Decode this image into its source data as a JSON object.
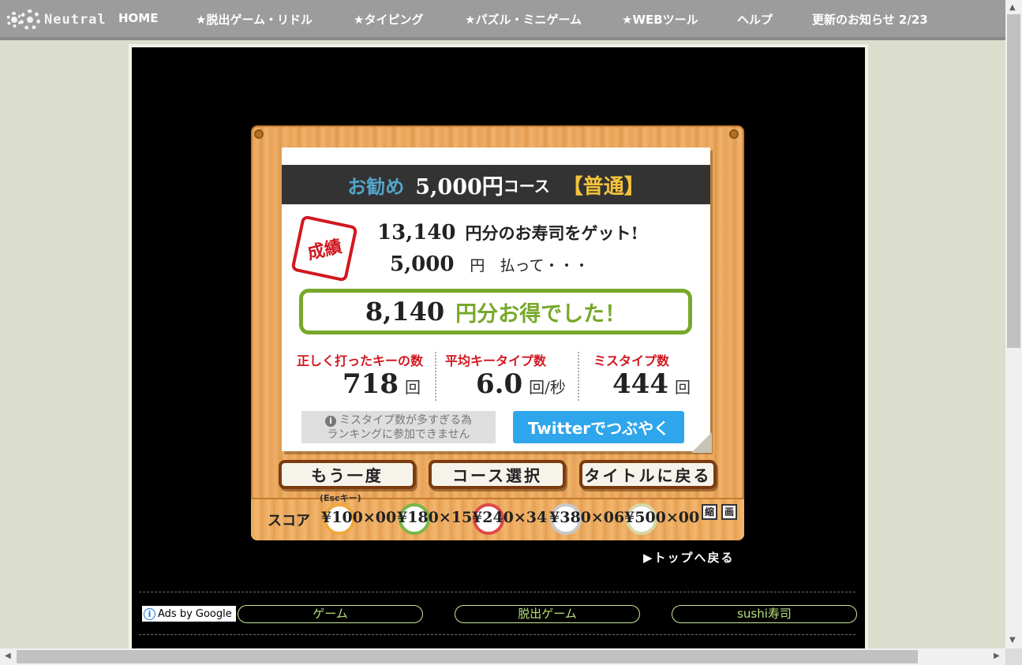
{
  "site": {
    "logo_text": "Neutral",
    "nav": [
      {
        "label": "HOME"
      },
      {
        "label": "★脱出ゲーム・リドル"
      },
      {
        "label": "★タイピング"
      },
      {
        "label": "★パズル・ミニゲーム"
      },
      {
        "label": "★WEBツール"
      },
      {
        "label": "ヘルプ"
      },
      {
        "label": "更新のお知らせ 2/23"
      }
    ]
  },
  "result": {
    "course_recommend": "お勧め",
    "course_name": "5,000円",
    "course_suffix": "コース",
    "course_level": "【普通】",
    "stamp_text": "成績",
    "earned_value": "13,140",
    "earned_text": "円分のお寿司をゲット!",
    "paid_value": "5,000",
    "paid_text": "円　払って・・・",
    "profit_value": "8,140",
    "profit_text": "円分お得でした！",
    "stats": [
      {
        "label": "正しく打ったキーの数",
        "value": "718",
        "unit": "回"
      },
      {
        "label": "平均キータイプ数",
        "value": "6.0",
        "unit": "回/秒"
      },
      {
        "label": "ミスタイプ数",
        "value": "444",
        "unit": "回"
      }
    ],
    "notice_line1": "ミスタイプ数が多すぎる為",
    "notice_line2": "ランキングに参加できません",
    "twitter_label": "Twitterでつぶやく"
  },
  "buttons": {
    "retry": "もう一度",
    "esc_hint": "(Escキー)",
    "course_select": "コース選択",
    "back_title": "タイトルに戻る"
  },
  "score": {
    "label": "スコア",
    "plates": [
      {
        "text": "¥100×00",
        "color": "#f0a83c"
      },
      {
        "text": "¥180×15",
        "color": "#7ab648"
      },
      {
        "text": "¥240×34",
        "color": "#e04848"
      },
      {
        "text": "¥380×06",
        "color": "#c8c8c8"
      },
      {
        "text": "¥500×00",
        "color": "#d8d8a8"
      }
    ],
    "tiny_buttons": [
      "縮",
      "画"
    ]
  },
  "back_to_top": "▶トップへ戻る",
  "ads": {
    "label": "Ads by Google",
    "links": [
      "ゲーム",
      "脱出ゲーム",
      "sushi寿司"
    ]
  }
}
